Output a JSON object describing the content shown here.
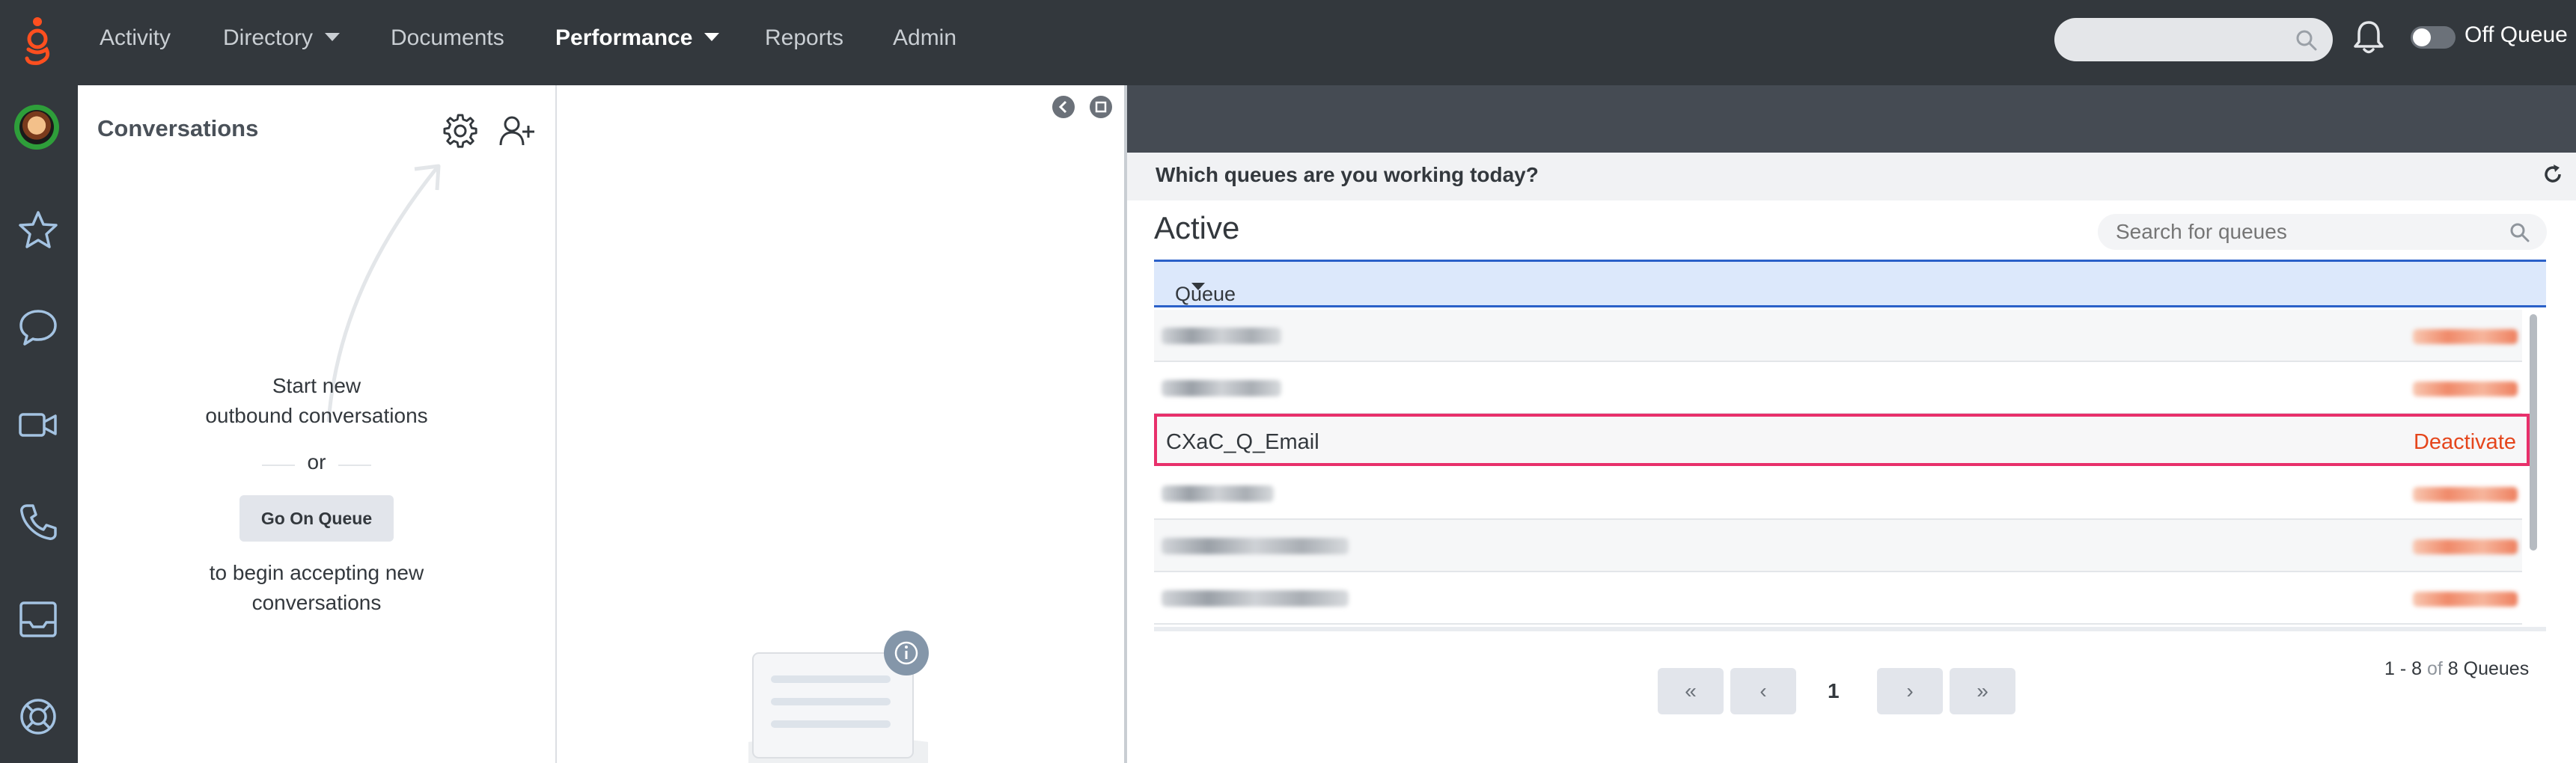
{
  "topnav": {
    "items": [
      {
        "label": "Activity"
      },
      {
        "label": "Directory"
      },
      {
        "label": "Documents"
      },
      {
        "label": "Performance"
      },
      {
        "label": "Reports"
      },
      {
        "label": "Admin"
      }
    ],
    "search_placeholder": "",
    "queue_toggle_label": "Off Queue",
    "queue_toggle_on": false
  },
  "sidebar": {
    "icons": [
      "avatar",
      "star-icon",
      "chat-icon",
      "video-icon",
      "phone-icon",
      "inbox-icon",
      "help-icon"
    ]
  },
  "conversations": {
    "title": "Conversations",
    "hint_line1": "Start new",
    "hint_line2": "outbound conversations",
    "or": "or",
    "button": "Go On Queue",
    "hint_line3": "to begin accepting new",
    "hint_line4": "conversations"
  },
  "queues": {
    "question": "Which queues are you working today?",
    "section_title": "Active",
    "search_placeholder": "Search for queues",
    "column_header": "Queue",
    "highlighted_row": {
      "name": "CXaC_Q_Email",
      "action": "Deactivate"
    },
    "pagination": {
      "first": "«",
      "prev": "‹",
      "current": "1",
      "next": "›",
      "last": "»",
      "range": "1 - 8",
      "of": "of",
      "total": "8 Queues"
    }
  },
  "colors": {
    "topbar": "#33383d",
    "accent_orange": "#e5461c",
    "highlight_border": "#e8306b",
    "header_blue": "#2a60c8"
  }
}
